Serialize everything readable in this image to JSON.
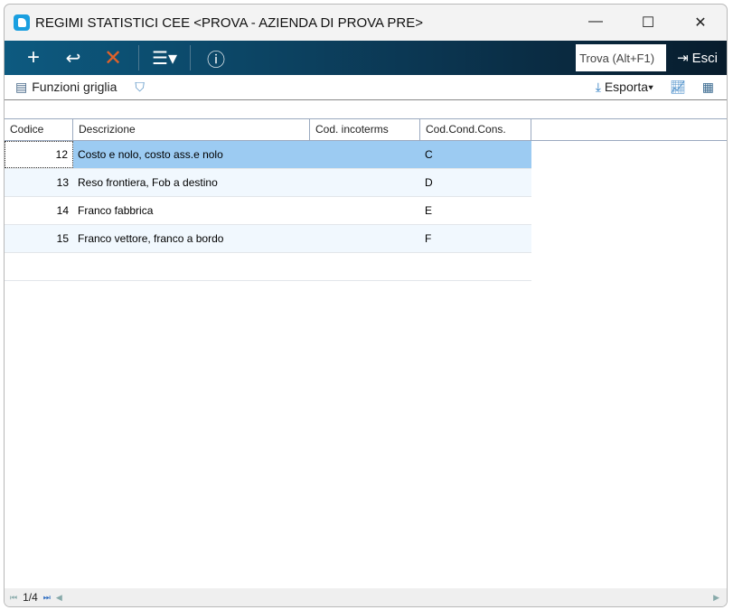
{
  "window": {
    "title": "REGIMI STATISTICI CEE <PROVA - AZIENDA DI PROVA PRE>"
  },
  "toolbar": {
    "find_placeholder": "Trova (Alt+F1)",
    "exit_label": "Esci"
  },
  "subbar": {
    "grid_functions": "Funzioni griglia",
    "export": "Esporta"
  },
  "grid": {
    "columns": [
      "Codice",
      "Descrizione",
      "Cod. incoterms",
      "Cod.Cond.Cons."
    ],
    "rows": [
      [
        "12",
        "Costo e nolo, costo ass.e nolo",
        "",
        "C"
      ],
      [
        "13",
        "Reso frontiera, Fob a destino",
        "",
        "D"
      ],
      [
        "14",
        "Franco fabbrica",
        "",
        "E"
      ],
      [
        "15",
        "Franco vettore, franco a bordo",
        "",
        "F"
      ]
    ]
  },
  "footer": {
    "page": "1/4"
  }
}
